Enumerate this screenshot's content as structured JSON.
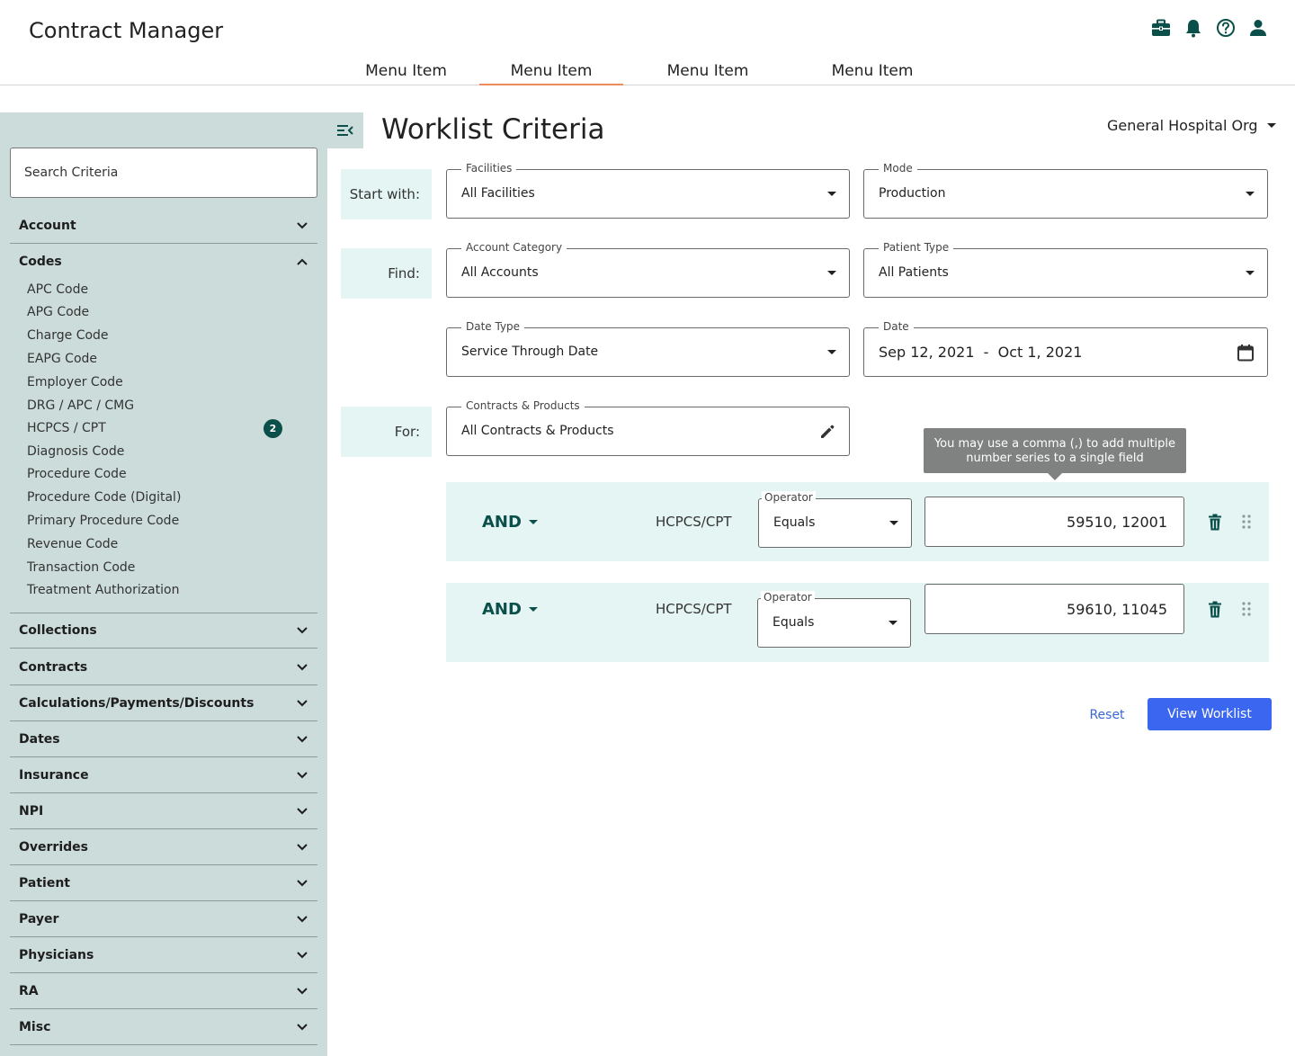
{
  "app": {
    "title": "Contract Manager"
  },
  "header_icons": [
    "briefcase-icon",
    "bell-icon",
    "help-icon",
    "user-icon"
  ],
  "nav": {
    "items": [
      "Menu Item",
      "Menu Item",
      "Menu Item",
      "Menu Item"
    ],
    "active_index": 1
  },
  "sidebar": {
    "search_placeholder": "Search Criteria",
    "sections": [
      "Account",
      "Codes",
      "Collections",
      "Contracts",
      "Calculations/Payments/Discounts",
      "Dates",
      "Insurance",
      "NPI",
      "Overrides",
      "Patient",
      "Payer",
      "Physicians",
      "RA",
      "Misc"
    ],
    "codes_items": [
      "APC Code",
      "APG Code",
      "Charge Code",
      "EAPG Code",
      "Employer Code",
      "DRG / APC / CMG",
      "HCPCS / CPT",
      "Diagnosis Code",
      "Procedure Code",
      "Procedure Code (Digital)",
      "Primary Procedure Code",
      "Revenue Code",
      "Transaction Code",
      "Treatment Authorization"
    ],
    "hcpcs_badge": "2"
  },
  "main": {
    "title": "Worklist Criteria",
    "org": "General Hospital Org",
    "labels": {
      "start": "Start with:",
      "find": "Find:",
      "for": "For:"
    },
    "facilities": {
      "label": "Facilities",
      "value": "All Facilities"
    },
    "mode": {
      "label": "Mode",
      "value": "Production"
    },
    "account_category": {
      "label": "Account Category",
      "value": "All Accounts"
    },
    "patient_type": {
      "label": "Patient Type",
      "value": "All Patients"
    },
    "date_type": {
      "label": "Date Type",
      "value": "Service Through Date"
    },
    "date": {
      "label": "Date",
      "value": "Sep 12, 2021  -  Oct 1, 2021"
    },
    "contracts": {
      "label": "Contracts & Products",
      "value": "All Contracts & Products"
    },
    "tooltip": "You may use a comma (,) to add multiple number series to a single field",
    "rules": [
      {
        "conj": "AND",
        "code": "HCPCS/CPT",
        "operator_label": "Operator",
        "operator": "Equals",
        "value": "59510, 12001"
      },
      {
        "conj": "AND",
        "code": "HCPCS/CPT",
        "operator_label": "Operator",
        "operator": "Equals",
        "value": "59610, 11045"
      }
    ],
    "reset_label": "Reset",
    "view_label": "View Worklist"
  },
  "colors": {
    "accent_teal": "#0b4f4a",
    "sidebar_bg": "#ccdcdb",
    "row_bg": "#e5f5f3",
    "primary_blue": "#3b66f0",
    "nav_active": "#f08a5d"
  }
}
